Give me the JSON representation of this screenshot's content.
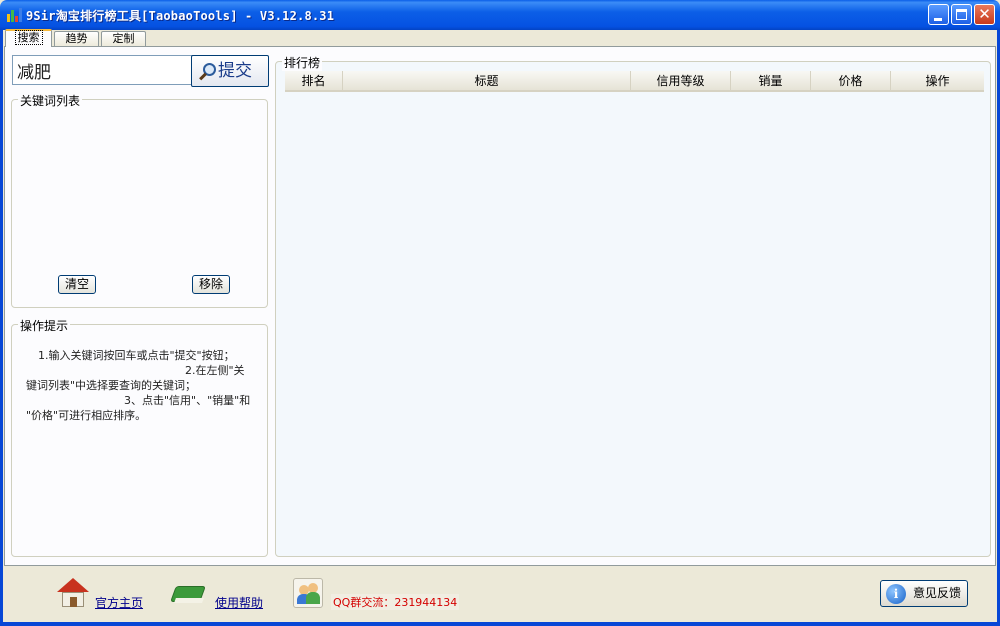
{
  "window": {
    "title": "9Sir淘宝排行榜工具[TaobaoTools] - V3.12.8.31"
  },
  "tabs": [
    {
      "label": "搜索",
      "active": true
    },
    {
      "label": "趋势",
      "active": false
    },
    {
      "label": "定制",
      "active": false
    }
  ],
  "search": {
    "value": "减肥",
    "submit_label": "提交"
  },
  "keyword_panel": {
    "title": "关键词列表",
    "items": [],
    "clear_label": "清空",
    "remove_label": "移除"
  },
  "tips": {
    "title": "操作提示",
    "lines": [
      "1.输入关键词按回车或点击\"提交\"按钮；",
      "2.在左侧\"关",
      "键词列表\"中选择要查询的关键词；",
      "3、点击\"信用\"、\"销量\"和",
      "\"价格\"可进行相应排序。"
    ]
  },
  "ranking": {
    "title": "排行榜",
    "columns": [
      "排名",
      "标题",
      "信用等级",
      "销量",
      "价格",
      "操作"
    ],
    "rows": []
  },
  "footer": {
    "home_label": "官方主页",
    "help_label": "使用帮助",
    "qq_text": "QQ群交流：231944134",
    "feedback_label": "意见反馈"
  },
  "icons": {
    "app": "bar-chart-icon",
    "home": "house-icon",
    "help": "book-icon",
    "qq": "users-icon",
    "feedback": "info-icon",
    "search": "magnifier-icon"
  },
  "colors": {
    "titlebar": "#0554e3",
    "qq_text": "#d40000",
    "link": "#00008b"
  }
}
